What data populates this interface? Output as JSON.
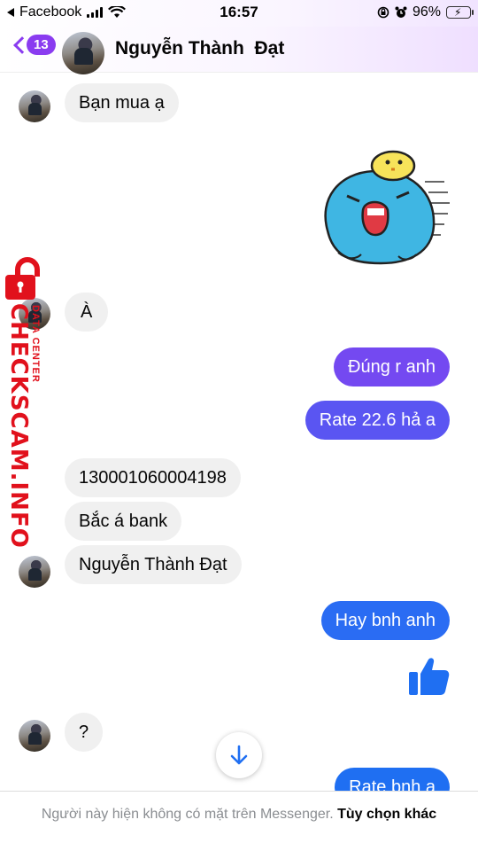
{
  "status_bar": {
    "back_app": "Facebook",
    "time": "16:57",
    "battery": "96%"
  },
  "header": {
    "back_badge": "13",
    "contact_name": "Nguyễn Thành  Đạt"
  },
  "messages": [
    {
      "dir": "in",
      "text": "Bạn mua ạ"
    },
    {
      "dir": "out",
      "type": "sticker"
    },
    {
      "dir": "in",
      "text": "À"
    },
    {
      "dir": "out",
      "text": "Đúng r anh"
    },
    {
      "dir": "out",
      "text": "Rate 22.6 hả a"
    },
    {
      "dir": "in",
      "text": "130001060004198"
    },
    {
      "dir": "in",
      "text": "Bắc á bank"
    },
    {
      "dir": "in",
      "text": "Nguyễn Thành Đạt"
    },
    {
      "dir": "out",
      "text": "Hay bnh anh"
    },
    {
      "dir": "out",
      "type": "like"
    },
    {
      "dir": "in",
      "text": "?"
    },
    {
      "dir": "out",
      "text": "Rate bnh a"
    }
  ],
  "watermark": {
    "main": "CHECKSCAM.INFO",
    "sub": "DATA CENTER"
  },
  "footer": {
    "notice": "Người này hiện không có mặt trên Messenger.",
    "option": "Tùy chọn khác"
  },
  "colors": {
    "accent": "#8a3cf0",
    "bubble_out_top": "#7a4cf3",
    "bubble_out_bottom": "#1f6ff2",
    "bubble_in": "#f0f0f0",
    "watermark": "#e1111c"
  }
}
